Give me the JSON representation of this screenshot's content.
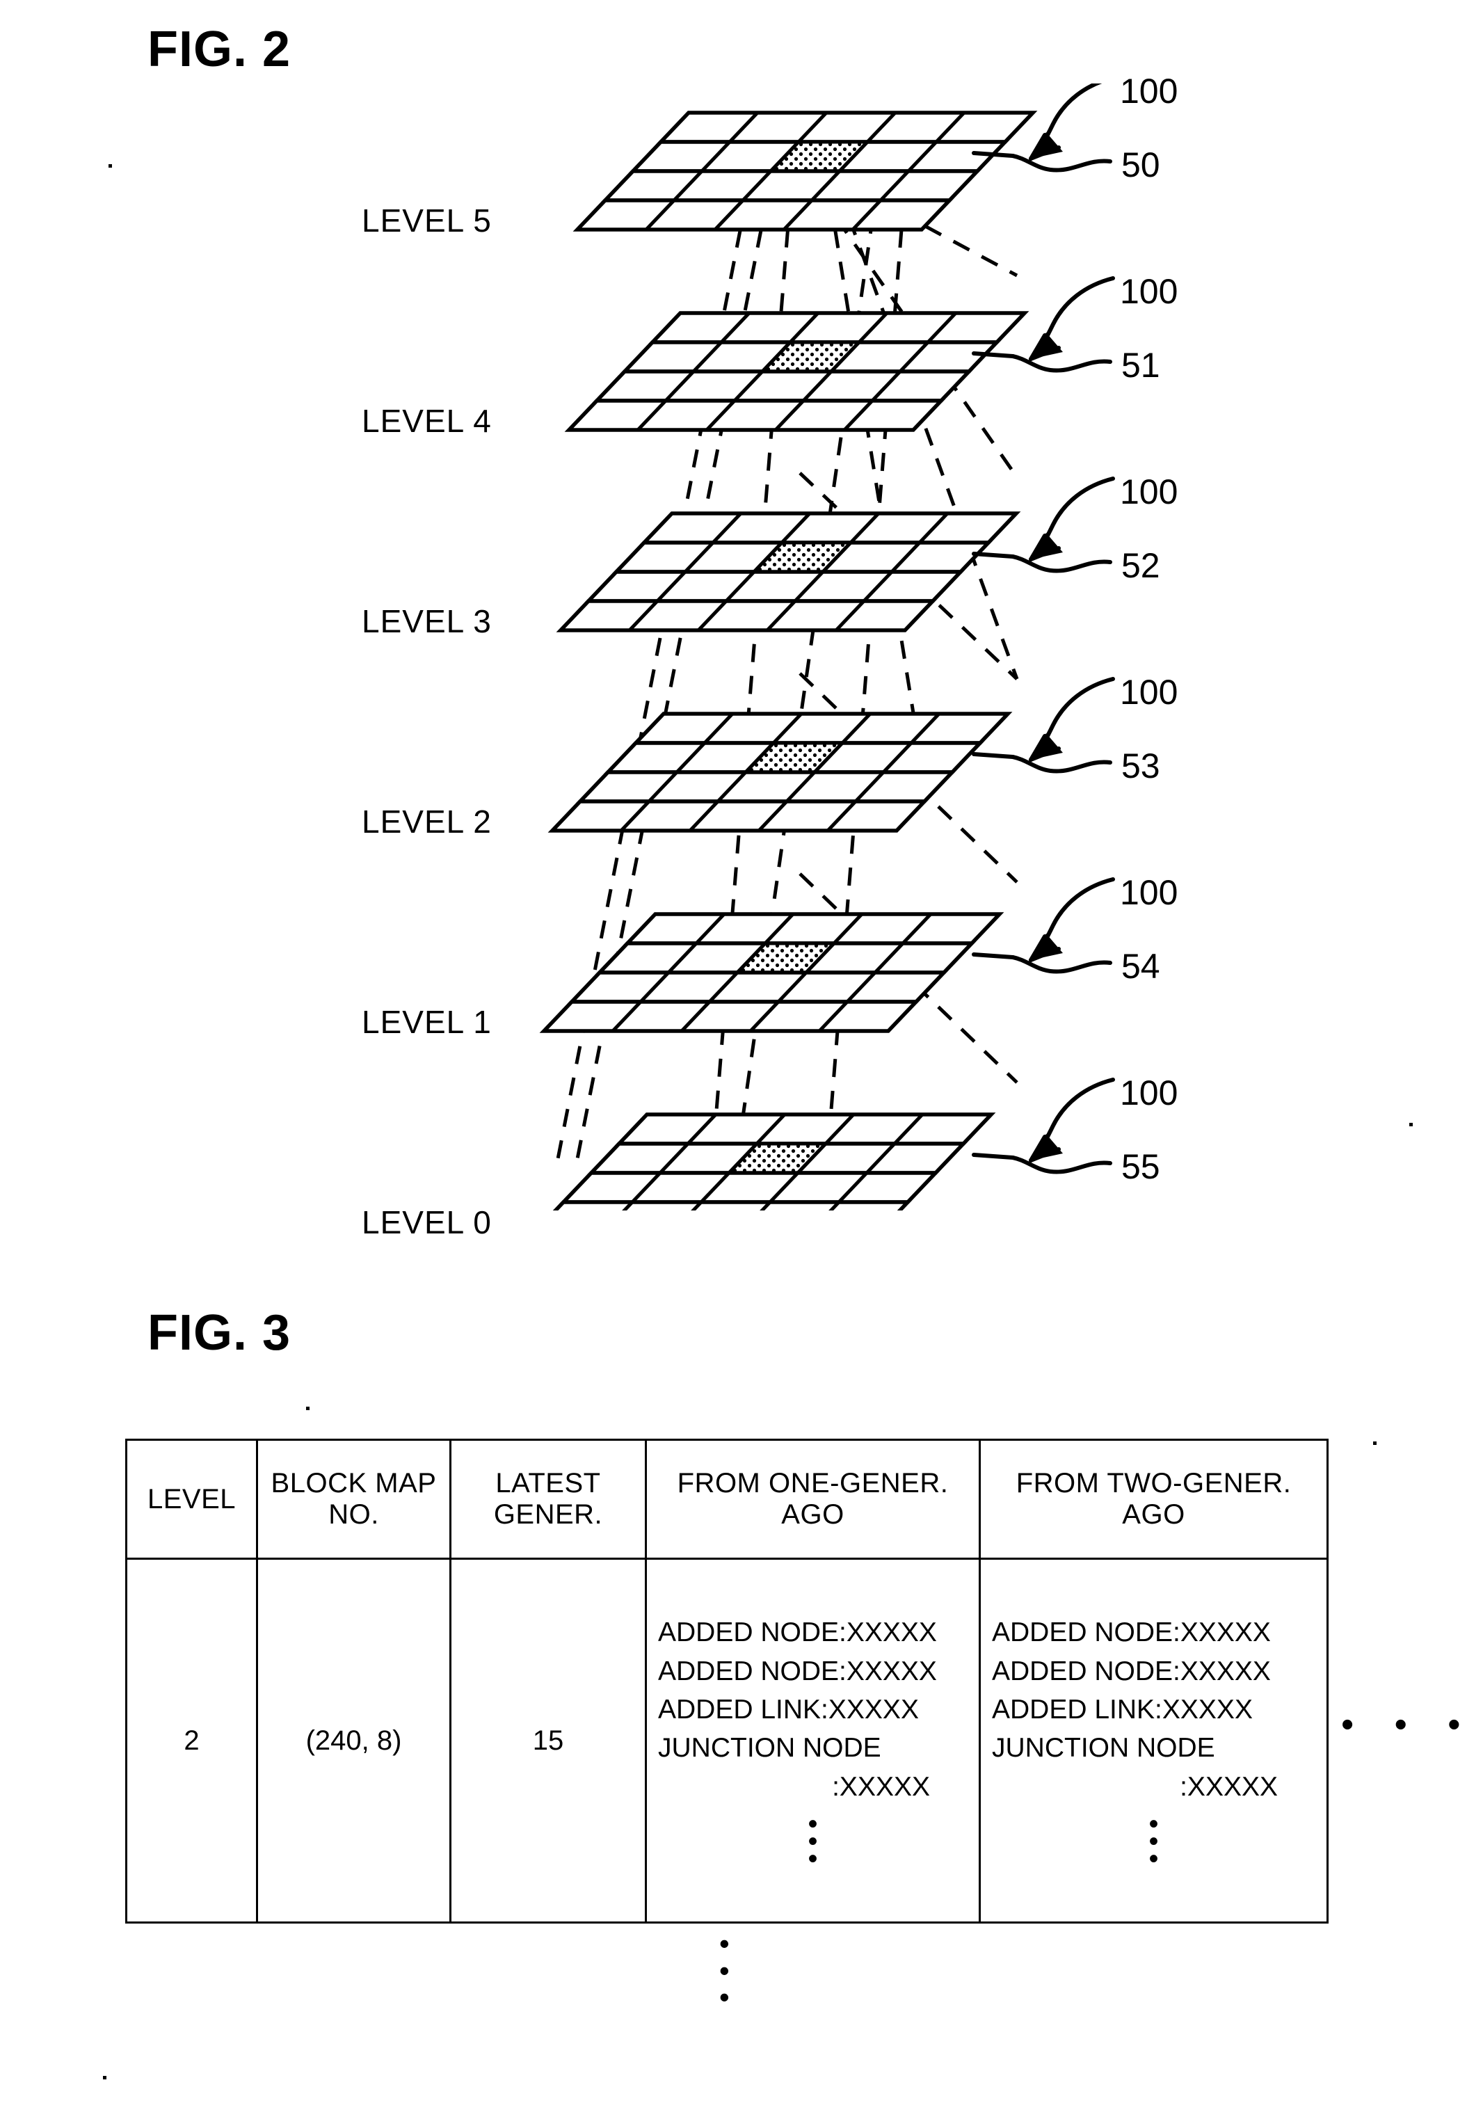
{
  "figures": {
    "fig2": {
      "title": "FIG. 2",
      "levels": [
        {
          "label": "LEVEL 5",
          "mesh_ref": "50",
          "layer_ref": "100"
        },
        {
          "label": "LEVEL 4",
          "mesh_ref": "51",
          "layer_ref": "100"
        },
        {
          "label": "LEVEL 3",
          "mesh_ref": "52",
          "layer_ref": "100"
        },
        {
          "label": "LEVEL 2",
          "mesh_ref": "53",
          "layer_ref": "100"
        },
        {
          "label": "LEVEL 1",
          "mesh_ref": "54",
          "layer_ref": "100"
        },
        {
          "label": "LEVEL 0",
          "mesh_ref": "55",
          "layer_ref": "100"
        }
      ]
    },
    "fig3": {
      "title": "FIG. 3",
      "table": {
        "headers": [
          "LEVEL",
          "BLOCK MAP\nNO.",
          "LATEST\nGENER.",
          "FROM ONE-GENER.\nAGO",
          "FROM TWO-GENER.\nAGO"
        ],
        "header_lines": {
          "level": [
            "LEVEL"
          ],
          "block_map_no": [
            "BLOCK MAP",
            "NO."
          ],
          "latest_gener": [
            "LATEST",
            "GENER."
          ],
          "from_one_gener_ago": [
            "FROM ONE-GENER.",
            "AGO"
          ],
          "from_two_gener_ago": [
            "FROM TWO-GENER.",
            "AGO"
          ]
        },
        "rows": [
          {
            "level": "2",
            "block_map_no": "(240, 8)",
            "latest_gener": "15",
            "from_one_gener_ago": {
              "lines": [
                "ADDED NODE:XXXXX",
                "ADDED NODE:XXXXX",
                "ADDED LINK:XXXXX",
                "JUNCTION NODE"
              ],
              "indent_line": ":XXXXX",
              "ellipsis": "•"
            },
            "from_two_gener_ago": {
              "lines": [
                "ADDED NODE:XXXXX",
                "ADDED NODE:XXXXX",
                "ADDED LINK:XXXXX",
                "JUNCTION NODE"
              ],
              "indent_line": ":XXXXX",
              "ellipsis": "•"
            }
          }
        ],
        "right_ellipsis": "• • •",
        "below_ellipsis": "•"
      }
    }
  },
  "colors": {
    "ink": "#000000",
    "paper": "#ffffff",
    "stipple": "#000000"
  }
}
